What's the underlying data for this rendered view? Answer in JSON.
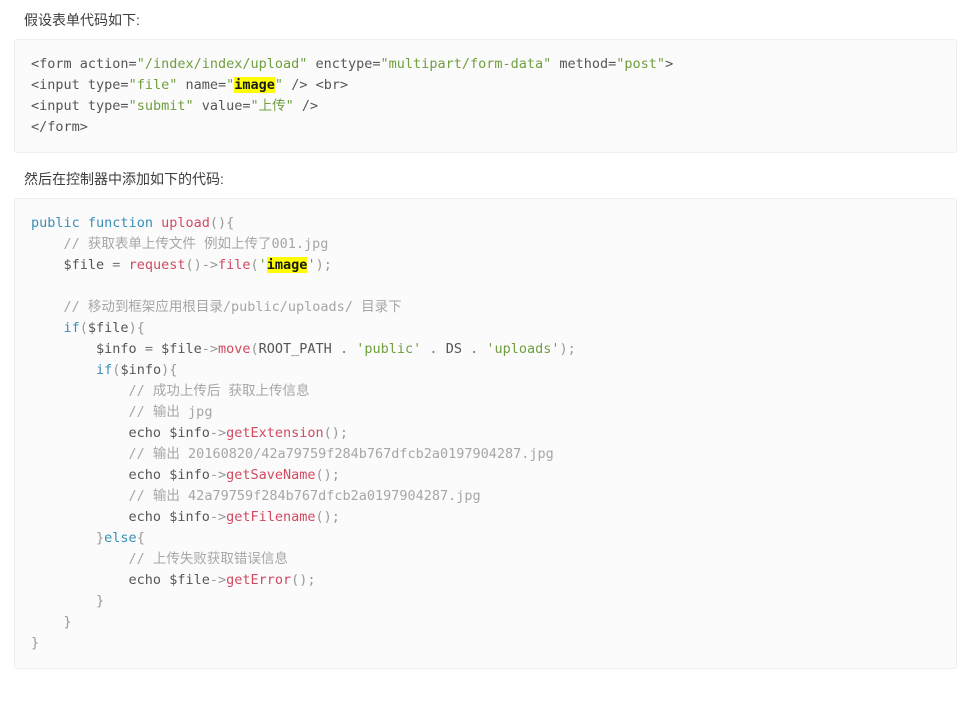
{
  "page": {
    "background": "#ffffff",
    "text_color": "#3b3b3b",
    "code_bg": "#fbfbfb",
    "code_border": "#eeeeee",
    "highlight_color": "#ffff00",
    "string_color": "#6f9f3f",
    "keyword_color": "#3a8fb7",
    "function_color": "#d14a61",
    "comment_color": "#a6a6a6"
  },
  "paragraphs": {
    "first": "假设表单代码如下:",
    "second": "然后在控制器中添加如下的代码:"
  },
  "code_block_1": {
    "language": "html",
    "highlight_token": "image",
    "lines": [
      "<form action=\"/index/index/upload\" enctype=\"multipart/form-data\" method=\"post\">",
      "<input type=\"file\" name=\"image\" /> <br>",
      "<input type=\"submit\" value=\"上传\" />",
      "</form>"
    ],
    "raw": "<form action=\"/index/index/upload\" enctype=\"multipart/form-data\" method=\"post\">\n<input type=\"file\" name=\"image\" /> <br>\n<input type=\"submit\" value=\"上传\" />\n</form>"
  },
  "code_block_2": {
    "language": "php",
    "highlight_token": "image",
    "lines": [
      "public function upload(){",
      "    // 获取表单上传文件 例如上传了001.jpg",
      "    $file = request()->file('image');",
      "",
      "    // 移动到框架应用根目录/public/uploads/ 目录下",
      "    if($file){",
      "        $info = $file->move(ROOT_PATH . 'public' . DS . 'uploads');",
      "        if($info){",
      "            // 成功上传后 获取上传信息",
      "            // 输出 jpg",
      "            echo $info->getExtension();",
      "            // 输出 20160820/42a79759f284b767dfcb2a0197904287.jpg",
      "            echo $info->getSaveName();",
      "            // 输出 42a79759f284b767dfcb2a0197904287.jpg",
      "            echo $info->getFilename();",
      "        }else{",
      "            // 上传失败获取错误信息",
      "            echo $file->getError();",
      "        }",
      "    }",
      "}"
    ],
    "tokens": {
      "keywords": [
        "public",
        "function",
        "if",
        "else",
        "echo"
      ],
      "functions": [
        "upload",
        "request",
        "file",
        "move",
        "getExtension",
        "getSaveName",
        "getFilename",
        "getError"
      ],
      "variables": [
        "$file",
        "$info"
      ],
      "constants": [
        "ROOT_PATH",
        "DS"
      ],
      "strings": [
        "'image'",
        "'public'",
        "'uploads'"
      ],
      "comments": [
        "// 获取表单上传文件 例如上传了001.jpg",
        "// 移动到框架应用根目录/public/uploads/ 目录下",
        "// 成功上传后 获取上传信息",
        "// 输出 jpg",
        "// 输出 20160820/42a79759f284b767dfcb2a0197904287.jpg",
        "// 输出 42a79759f284b767dfcb2a0197904287.jpg",
        "// 上传失败获取错误信息"
      ]
    },
    "output_examples": {
      "extension": "jpg",
      "save_name": "20160820/42a79759f284b767dfcb2a0197904287.jpg",
      "filename": "42a79759f284b767dfcb2a0197904287.jpg"
    },
    "path_parts": {
      "root_const": "ROOT_PATH",
      "public_dir": "public",
      "ds_const": "DS",
      "uploads_dir": "uploads"
    }
  }
}
